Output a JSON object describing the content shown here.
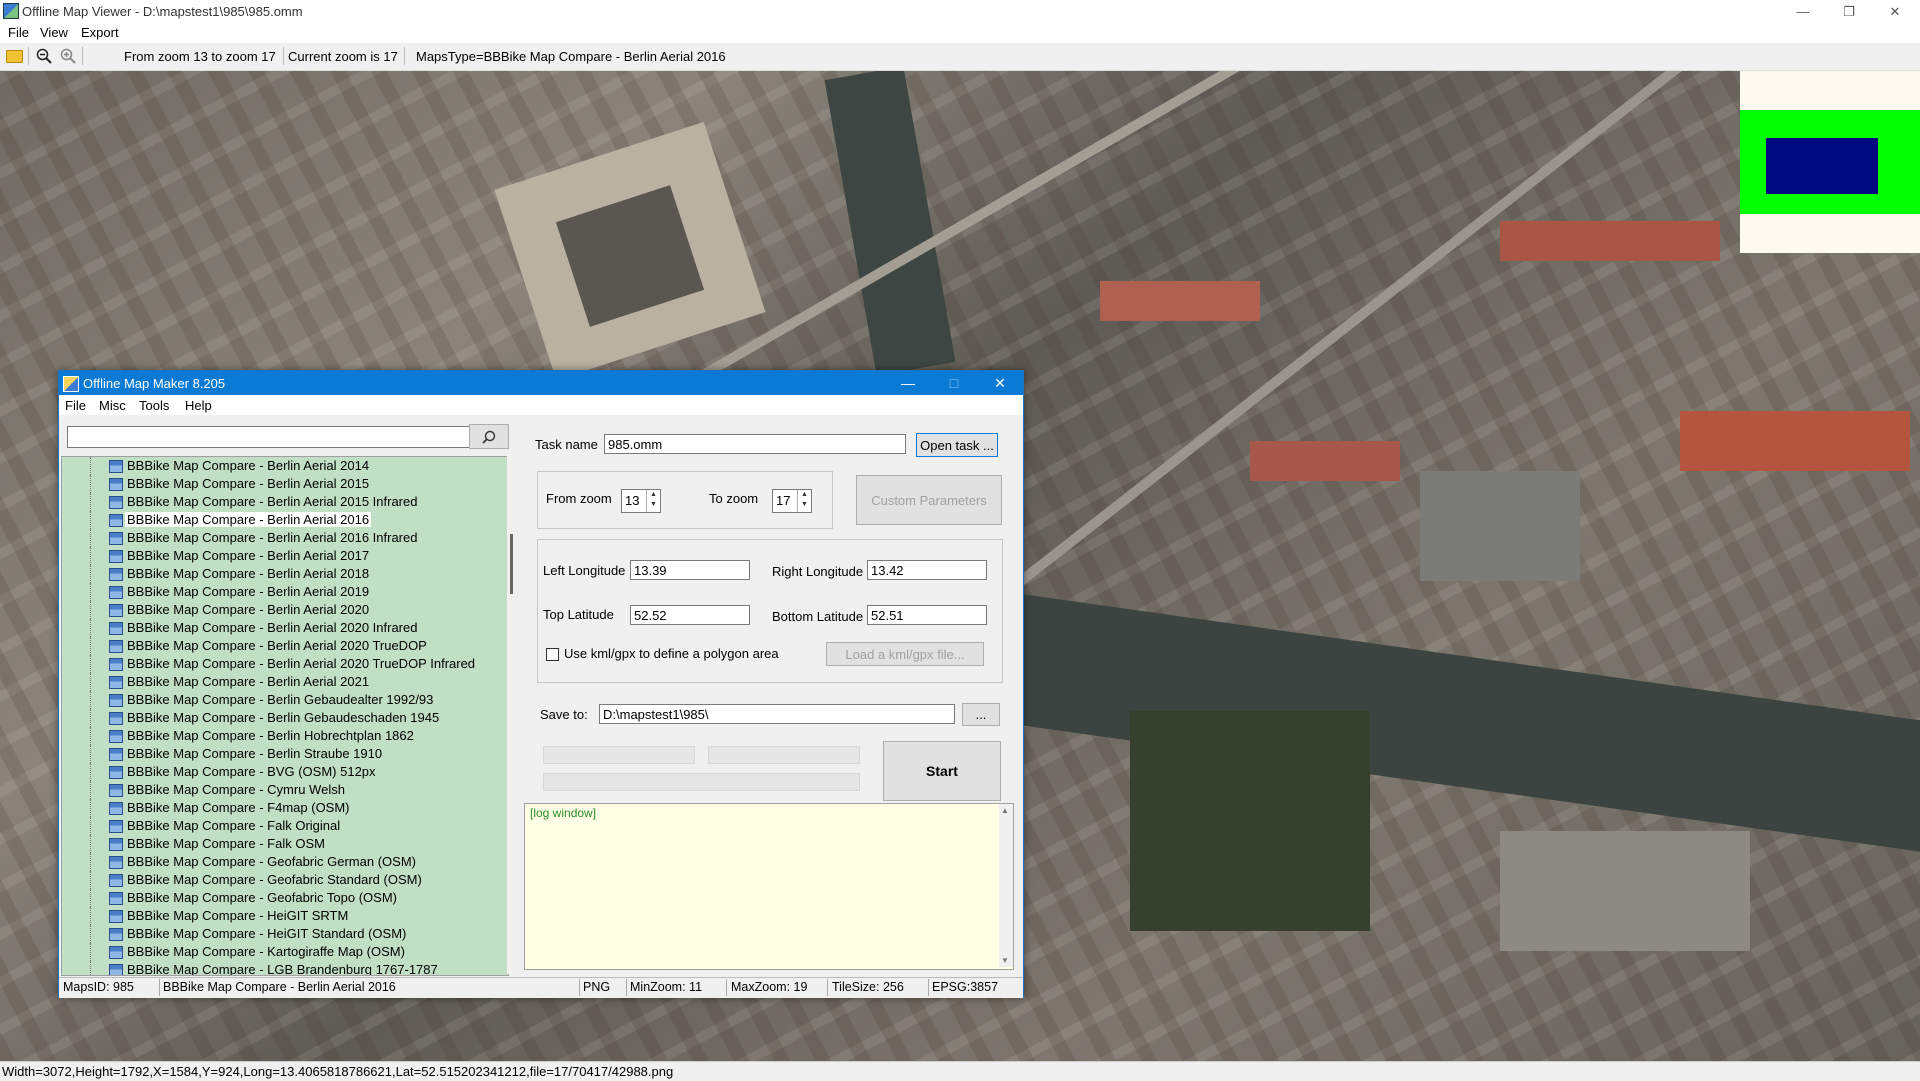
{
  "viewer": {
    "title": "Offline Map Viewer - D:\\mapstest1\\985\\985.omm",
    "menu": [
      "File",
      "View",
      "Export"
    ],
    "toolbar": {
      "zoom_range": "From zoom 13 to zoom 17",
      "current_zoom": "Current zoom is 17",
      "maps_type": "MapsType=BBBike Map Compare - Berlin Aerial 2016"
    },
    "status": "Width=3072,Height=1792,X=1584,Y=924,Long=13.4065818786621,Lat=52.515202341212,file=17/70417/42988.png",
    "overview_colors": {
      "background": "#fffaf0",
      "outer": "#00ff00",
      "inner": "#000a80"
    }
  },
  "dialog": {
    "title": "Offline Map Maker 8.205",
    "menu": [
      "File",
      "Misc",
      "Tools",
      "Help"
    ],
    "search": {
      "value": ""
    },
    "tree_items": [
      "BBBike Map Compare - Berlin Aerial 2014",
      "BBBike Map Compare - Berlin Aerial 2015",
      "BBBike Map Compare - Berlin Aerial 2015 Infrared",
      "BBBike Map Compare - Berlin Aerial 2016",
      "BBBike Map Compare - Berlin Aerial 2016 Infrared",
      "BBBike Map Compare - Berlin Aerial 2017",
      "BBBike Map Compare - Berlin Aerial 2018",
      "BBBike Map Compare - Berlin Aerial 2019",
      "BBBike Map Compare - Berlin Aerial 2020",
      "BBBike Map Compare - Berlin Aerial 2020 Infrared",
      "BBBike Map Compare - Berlin Aerial 2020 TrueDOP",
      "BBBike Map Compare - Berlin Aerial 2020 TrueDOP Infrared",
      "BBBike Map Compare - Berlin Aerial 2021",
      "BBBike Map Compare - Berlin Gebaudealter 1992/93",
      "BBBike Map Compare - Berlin Gebaudeschaden 1945",
      "BBBike Map Compare - Berlin Hobrechtplan 1862",
      "BBBike Map Compare - Berlin Straube 1910",
      "BBBike Map Compare - BVG (OSM) 512px",
      "BBBike Map Compare - Cymru Welsh",
      "BBBike Map Compare - F4map (OSM)",
      "BBBike Map Compare - Falk Original",
      "BBBike Map Compare - Falk OSM",
      "BBBike Map Compare - Geofabric German (OSM)",
      "BBBike Map Compare - Geofabric Standard (OSM)",
      "BBBike Map Compare - Geofabric Topo (OSM)",
      "BBBike Map Compare - HeiGIT SRTM",
      "BBBike Map Compare - HeiGIT Standard (OSM)",
      "BBBike Map Compare - Kartogiraffe Map (OSM)",
      "BBBike Map Compare - LGB Brandenburg 1767-1787"
    ],
    "selected_index": 3,
    "task_name_label": "Task name",
    "task_name": "985.omm",
    "open_task_label": "Open task ...",
    "from_zoom_label": "From zoom",
    "from_zoom": "13",
    "to_zoom_label": "To zoom",
    "to_zoom": "17",
    "custom_params_label": "Custom Parameters",
    "left_lon_label": "Left Longitude",
    "left_lon": "13.39",
    "right_lon_label": "Right Longitude",
    "right_lon": "13.42",
    "top_lat_label": "Top Latitude",
    "top_lat": "52.52",
    "bottom_lat_label": "Bottom Latitude",
    "bottom_lat": "52.51",
    "kml_label": "Use kml/gpx to define a polygon area",
    "load_kml_label": "Load a kml/gpx file...",
    "save_to_label": "Save to:",
    "save_to": "D:\\mapstest1\\985\\",
    "browse_label": "...",
    "start_label": "Start",
    "log_text": "[log window]",
    "status": {
      "maps_id": "MapsID: 985",
      "maps_name": "BBBike Map Compare - Berlin Aerial 2016",
      "format": "PNG",
      "min_zoom": "MinZoom: 11",
      "max_zoom": "MaxZoom: 19",
      "tile_size": "TileSize: 256",
      "epsg": "EPSG:3857"
    }
  }
}
